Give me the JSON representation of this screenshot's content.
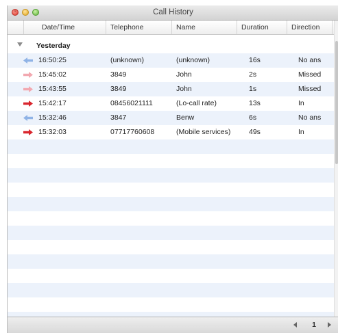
{
  "window": {
    "title": "Call History",
    "close_glyph": "×",
    "min_glyph": "",
    "max_glyph": ""
  },
  "columns": {
    "datetime": "Date/Time",
    "telephone": "Telephone",
    "name": "Name",
    "duration": "Duration",
    "direction": "Direction"
  },
  "group": {
    "label": "Yesterday"
  },
  "calls": [
    {
      "time": "16:50:25",
      "telephone": "(unknown)",
      "name": "(unknown)",
      "duration": "16s",
      "direction": "No ans",
      "icon": "arrow-outgoing-icon",
      "color": "#8fb3e6"
    },
    {
      "time": "15:45:02",
      "telephone": "3849",
      "name": "John",
      "duration": "2s",
      "direction": "Missed",
      "icon": "arrow-missed-icon",
      "color": "#f2a8b0"
    },
    {
      "time": "15:43:55",
      "telephone": "3849",
      "name": "John",
      "duration": "1s",
      "direction": "Missed",
      "icon": "arrow-missed-icon",
      "color": "#f2a8b0"
    },
    {
      "time": "15:42:17",
      "telephone": "08456021111",
      "name": "(Lo-call rate)",
      "duration": "13s",
      "direction": "In",
      "icon": "arrow-incoming-icon",
      "color": "#d9262e"
    },
    {
      "time": "15:32:46",
      "telephone": "3847",
      "name": "Benw",
      "duration": "6s",
      "direction": "No ans",
      "icon": "arrow-outgoing-icon",
      "color": "#8fb3e6"
    },
    {
      "time": "15:32:03",
      "telephone": "07717760608",
      "name": "(Mobile services)",
      "duration": "49s",
      "direction": "In",
      "icon": "arrow-incoming-icon",
      "color": "#d9262e"
    }
  ],
  "footer": {
    "page": "1"
  }
}
